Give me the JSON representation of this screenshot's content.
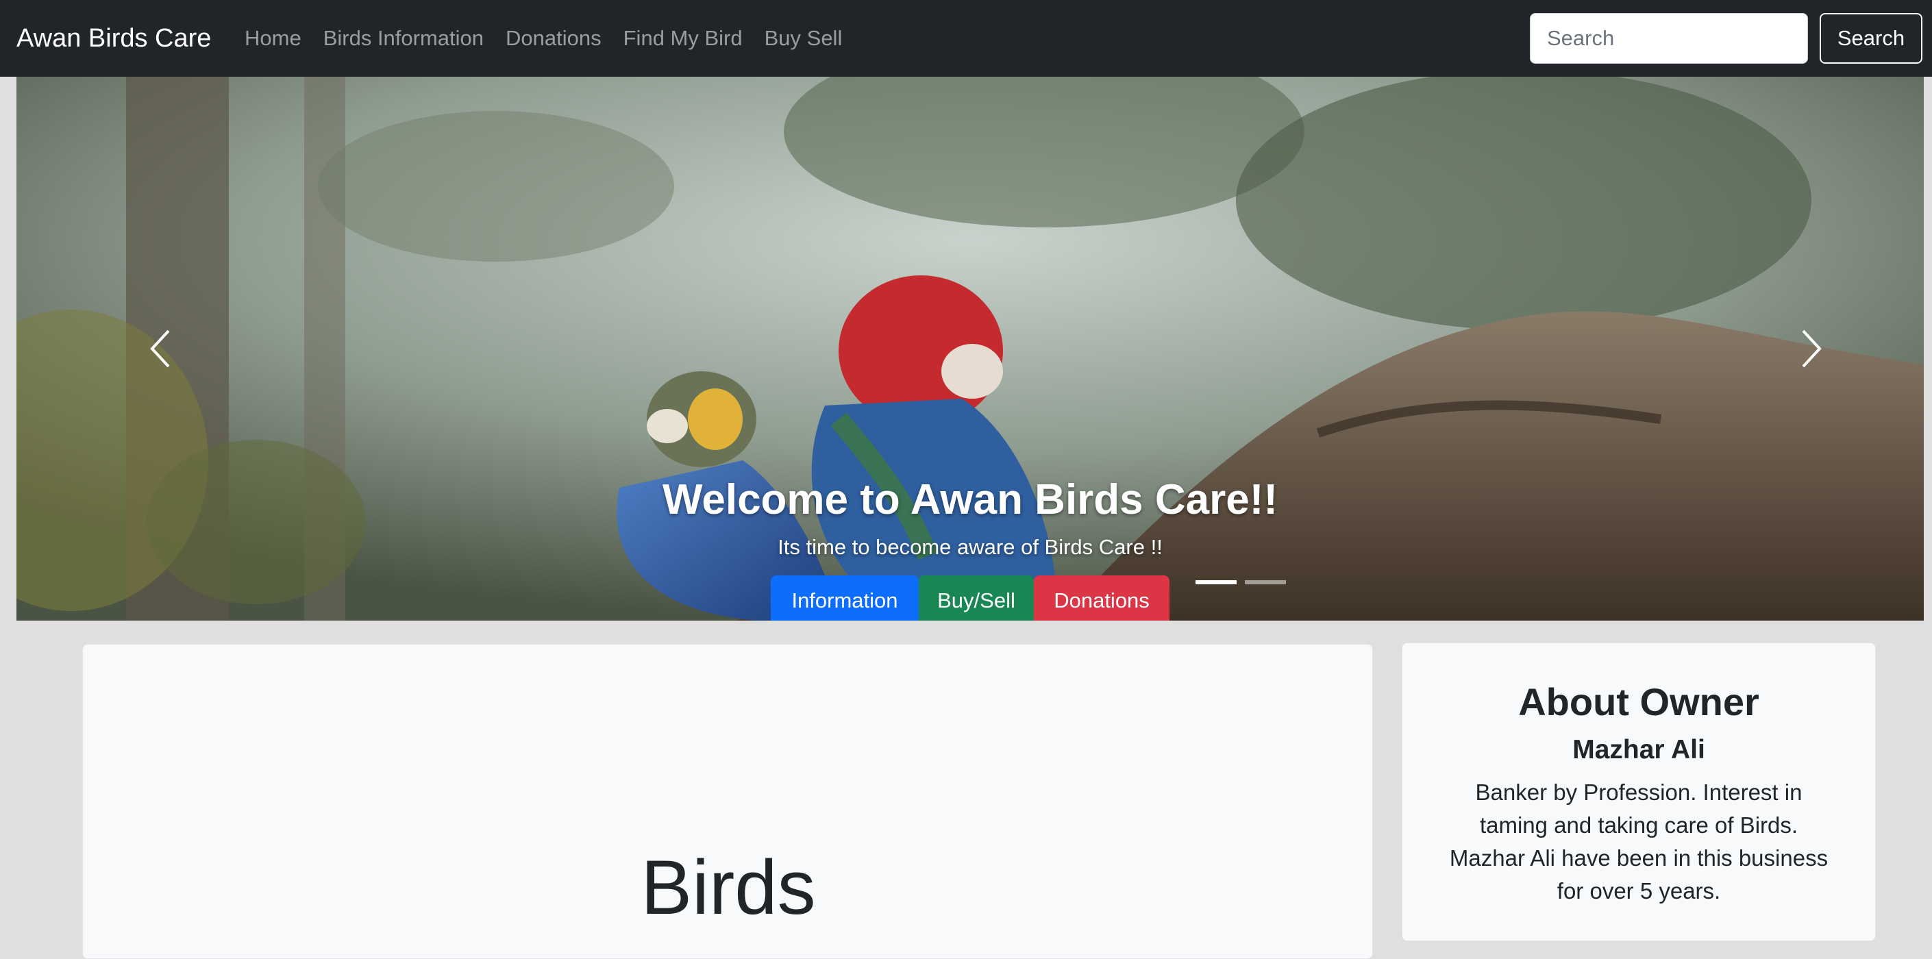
{
  "navbar": {
    "brand": "Awan Birds Care",
    "links": [
      "Home",
      "Birds Information",
      "Donations",
      "Find My Bird",
      "Buy Sell"
    ],
    "search_placeholder": "Search",
    "search_button": "Search"
  },
  "hero": {
    "title": "Welcome to Awan Birds Care!!",
    "subtitle": "Its time to become aware of Birds Care !!",
    "buttons": [
      "Information",
      "Buy/Sell",
      "Donations"
    ],
    "slides_count": 2,
    "active_slide": 1
  },
  "main": {
    "heading": "Birds"
  },
  "about": {
    "title": "About Owner",
    "name": "Mazhar Ali",
    "description": "Banker by Profession. Interest in taming and taking care of Birds. Mazhar Ali have been in this business for over 5 years."
  },
  "colors": {
    "navbar_bg": "#212529",
    "page_bg": "#dfdfdf",
    "primary": "#0d6efd",
    "success": "#198754",
    "danger": "#dc3545",
    "card_bg": "#f8f9fa"
  }
}
